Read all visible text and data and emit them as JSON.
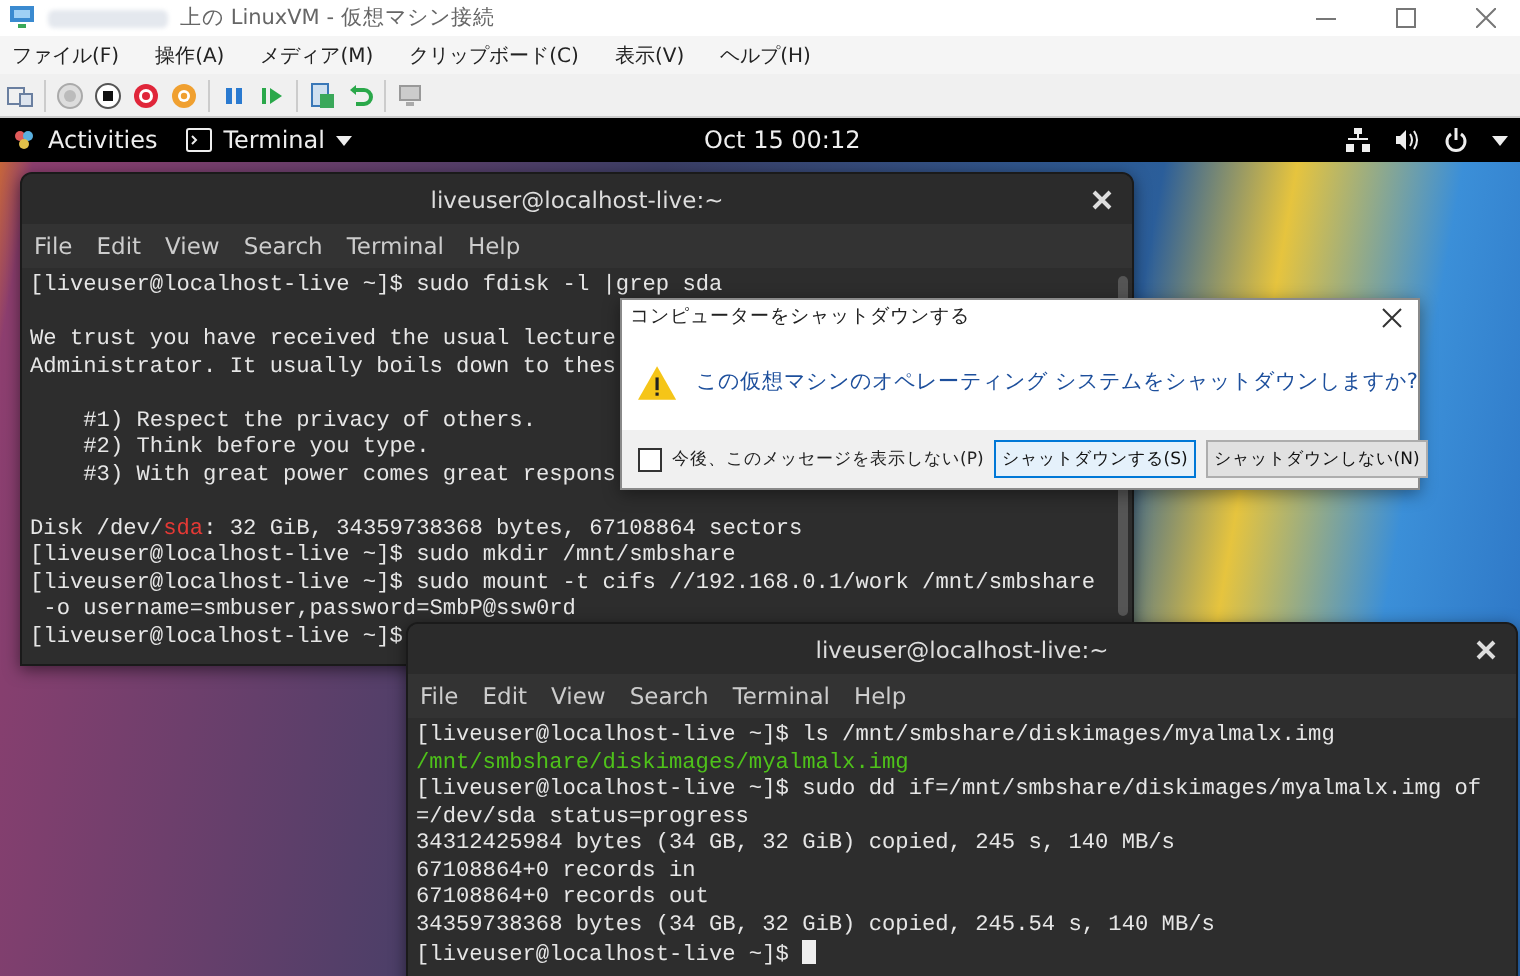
{
  "host_window": {
    "title": "上の LinuxVM - 仮想マシン接続",
    "menu": [
      "ファイル(F)",
      "操作(A)",
      "メディア(M)",
      "クリップボード(C)",
      "表示(V)",
      "ヘルプ(H)"
    ]
  },
  "top_bar": {
    "activities": "Activities",
    "app_menu": "Terminal",
    "clock": "Oct 15 00:12"
  },
  "terminals": [
    {
      "title": "liveuser@localhost-live:~",
      "menu": [
        "File",
        "Edit",
        "View",
        "Search",
        "Terminal",
        "Help"
      ],
      "cursor": false,
      "lines": [
        {
          "kind": "text",
          "segments": [
            {
              "text": "[liveuser@localhost-live ~]$ sudo fdisk -l |grep sda",
              "color": "#e6e6e6"
            }
          ]
        },
        {
          "kind": "blank"
        },
        {
          "kind": "text",
          "segments": [
            {
              "text": "We trust you have received the usual lecture",
              "color": "#e6e6e6"
            }
          ]
        },
        {
          "kind": "text",
          "segments": [
            {
              "text": "Administrator. It usually boils down to thes",
              "color": "#e6e6e6"
            }
          ]
        },
        {
          "kind": "blank"
        },
        {
          "kind": "text",
          "segments": [
            {
              "text": "    #1) Respect the privacy of others.",
              "color": "#e6e6e6"
            }
          ]
        },
        {
          "kind": "text",
          "segments": [
            {
              "text": "    #2) Think before you type.",
              "color": "#e6e6e6"
            }
          ]
        },
        {
          "kind": "text",
          "segments": [
            {
              "text": "    #3) With great power comes great respons",
              "color": "#e6e6e6"
            }
          ]
        },
        {
          "kind": "blank"
        },
        {
          "kind": "text",
          "segments": [
            {
              "text": "Disk /dev/",
              "color": "#e6e6e6"
            },
            {
              "text": "sda",
              "color": "#e53935"
            },
            {
              "text": ": 32 GiB, 34359738368 bytes, 67108864 sectors",
              "color": "#e6e6e6"
            }
          ]
        },
        {
          "kind": "text",
          "segments": [
            {
              "text": "[liveuser@localhost-live ~]$ sudo mkdir /mnt/smbshare",
              "color": "#e6e6e6"
            }
          ]
        },
        {
          "kind": "text",
          "segments": [
            {
              "text": "[liveuser@localhost-live ~]$ sudo mount -t cifs //192.168.0.1/work /mnt/smbshare",
              "color": "#e6e6e6"
            }
          ]
        },
        {
          "kind": "text",
          "segments": [
            {
              "text": " -o username=smbuser,password=SmbP@ssw0rd",
              "color": "#e6e6e6"
            }
          ]
        },
        {
          "kind": "text",
          "segments": [
            {
              "text": "[liveuser@localhost-live ~]$",
              "color": "#e6e6e6"
            }
          ]
        }
      ]
    },
    {
      "title": "liveuser@localhost-live:~",
      "menu": [
        "File",
        "Edit",
        "View",
        "Search",
        "Terminal",
        "Help"
      ],
      "cursor": true,
      "lines": [
        {
          "kind": "text",
          "segments": [
            {
              "text": "[liveuser@localhost-live ~]$ ls /mnt/smbshare/diskimages/myalmalx.img",
              "color": "#e6e6e6"
            }
          ]
        },
        {
          "kind": "text",
          "segments": [
            {
              "text": "/mnt/smbshare/diskimages/myalmalx.img",
              "color": "#4ec21a"
            }
          ]
        },
        {
          "kind": "text",
          "segments": [
            {
              "text": "[liveuser@localhost-live ~]$ sudo dd if=/mnt/smbshare/diskimages/myalmalx.img of",
              "color": "#e6e6e6"
            }
          ]
        },
        {
          "kind": "text",
          "segments": [
            {
              "text": "=/dev/sda status=progress",
              "color": "#e6e6e6"
            }
          ]
        },
        {
          "kind": "text",
          "segments": [
            {
              "text": "34312425984 bytes (34 GB, 32 GiB) copied, 245 s, 140 MB/s",
              "color": "#e6e6e6"
            }
          ]
        },
        {
          "kind": "text",
          "segments": [
            {
              "text": "67108864+0 records in",
              "color": "#e6e6e6"
            }
          ]
        },
        {
          "kind": "text",
          "segments": [
            {
              "text": "67108864+0 records out",
              "color": "#e6e6e6"
            }
          ]
        },
        {
          "kind": "text",
          "segments": [
            {
              "text": "34359738368 bytes (34 GB, 32 GiB) copied, 245.54 s, 140 MB/s",
              "color": "#e6e6e6"
            }
          ]
        },
        {
          "kind": "text",
          "segments": [
            {
              "text": "[liveuser@localhost-live ~]$ ",
              "color": "#e6e6e6"
            }
          ]
        }
      ]
    }
  ],
  "dialog": {
    "title": "コンピューターをシャットダウンする",
    "message": "この仮想マシンのオペレーティング システムをシャットダウンしますか?",
    "checkbox": {
      "label": "今後、このメッセージを表示しない(P)",
      "checked": false
    },
    "buttons": [
      {
        "label": "シャットダウンする(S)",
        "selected": true
      },
      {
        "label": "シャットダウンしない(N)",
        "selected": false
      }
    ]
  }
}
